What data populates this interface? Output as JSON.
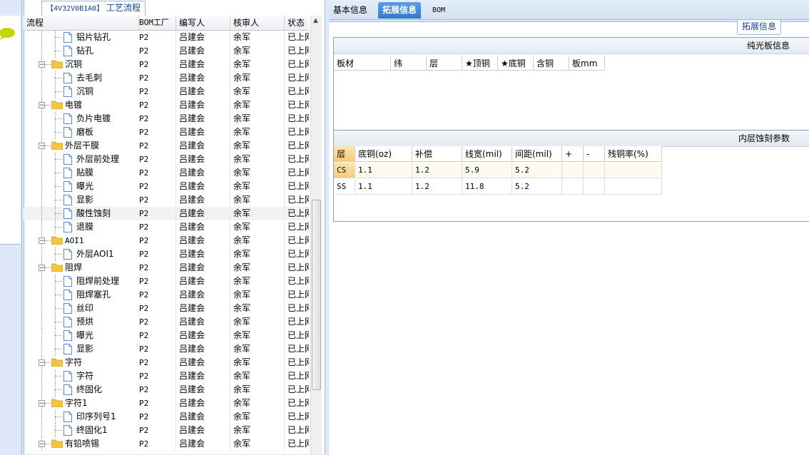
{
  "tree_panel": {
    "title_code": "【4V32V0B1A0】",
    "title": "工艺流程",
    "columns": [
      "流程",
      "BOM工厂",
      "编写人",
      "核审人",
      "状态"
    ],
    "rows": [
      {
        "name": "铝片钻孔",
        "type": "leaf",
        "factory": "P2",
        "writer": "吕建会",
        "reviewer": "余军",
        "status": "已上网"
      },
      {
        "name": "钻孔",
        "type": "leaf",
        "factory": "P2",
        "writer": "吕建会",
        "reviewer": "余军",
        "status": "已上网"
      },
      {
        "name": "沉铜",
        "type": "folder",
        "factory": "P2",
        "writer": "吕建会",
        "reviewer": "余军",
        "status": "已上网"
      },
      {
        "name": "去毛刺",
        "type": "leaf",
        "factory": "P2",
        "writer": "吕建会",
        "reviewer": "余军",
        "status": "已上网"
      },
      {
        "name": "沉铜",
        "type": "leaf",
        "factory": "P2",
        "writer": "吕建会",
        "reviewer": "余军",
        "status": "已上网"
      },
      {
        "name": "电镀",
        "type": "folder",
        "factory": "P2",
        "writer": "吕建会",
        "reviewer": "余军",
        "status": "已上网"
      },
      {
        "name": "负片电镀",
        "type": "leaf",
        "factory": "P2",
        "writer": "吕建会",
        "reviewer": "余军",
        "status": "已上网"
      },
      {
        "name": "磨板",
        "type": "leaf",
        "factory": "P2",
        "writer": "吕建会",
        "reviewer": "余军",
        "status": "已上网"
      },
      {
        "name": "外层干膜",
        "type": "folder",
        "factory": "P2",
        "writer": "吕建会",
        "reviewer": "余军",
        "status": "已上网"
      },
      {
        "name": "外层前处理",
        "type": "leaf",
        "factory": "P2",
        "writer": "吕建会",
        "reviewer": "余军",
        "status": "已上网"
      },
      {
        "name": "贴膜",
        "type": "leaf",
        "factory": "P2",
        "writer": "吕建会",
        "reviewer": "余军",
        "status": "已上网"
      },
      {
        "name": "曝光",
        "type": "leaf",
        "factory": "P2",
        "writer": "吕建会",
        "reviewer": "余军",
        "status": "已上网"
      },
      {
        "name": "显影",
        "type": "leaf",
        "factory": "P2",
        "writer": "吕建会",
        "reviewer": "余军",
        "status": "已上网"
      },
      {
        "name": "酸性蚀刻",
        "type": "leaf",
        "factory": "P2",
        "writer": "吕建会",
        "reviewer": "余军",
        "status": "已上网",
        "selected": true
      },
      {
        "name": "退膜",
        "type": "leaf",
        "factory": "P2",
        "writer": "吕建会",
        "reviewer": "余军",
        "status": "已上网"
      },
      {
        "name": "AOI1",
        "type": "folder",
        "factory": "P2",
        "writer": "吕建会",
        "reviewer": "余军",
        "status": "已上网"
      },
      {
        "name": "外层AOI1",
        "type": "leaf",
        "factory": "P2",
        "writer": "吕建会",
        "reviewer": "余军",
        "status": "已上网"
      },
      {
        "name": "阻焊",
        "type": "folder",
        "factory": "P2",
        "writer": "吕建会",
        "reviewer": "余军",
        "status": "已上网"
      },
      {
        "name": "阻焊前处理",
        "type": "leaf",
        "factory": "P2",
        "writer": "吕建会",
        "reviewer": "余军",
        "status": "已上网"
      },
      {
        "name": "阻焊塞孔",
        "type": "leaf",
        "factory": "P2",
        "writer": "吕建会",
        "reviewer": "余军",
        "status": "已上网"
      },
      {
        "name": "丝印",
        "type": "leaf",
        "factory": "P2",
        "writer": "吕建会",
        "reviewer": "余军",
        "status": "已上网"
      },
      {
        "name": "预烘",
        "type": "leaf",
        "factory": "P2",
        "writer": "吕建会",
        "reviewer": "余军",
        "status": "已上网"
      },
      {
        "name": "曝光",
        "type": "leaf",
        "factory": "P2",
        "writer": "吕建会",
        "reviewer": "余军",
        "status": "已上网"
      },
      {
        "name": "显影",
        "type": "leaf",
        "factory": "P2",
        "writer": "吕建会",
        "reviewer": "余军",
        "status": "已上网"
      },
      {
        "name": "字符",
        "type": "folder",
        "factory": "P2",
        "writer": "吕建会",
        "reviewer": "余军",
        "status": "已上网"
      },
      {
        "name": "字符",
        "type": "leaf",
        "factory": "P2",
        "writer": "吕建会",
        "reviewer": "余军",
        "status": "已上网"
      },
      {
        "name": "终固化",
        "type": "leaf",
        "factory": "P2",
        "writer": "吕建会",
        "reviewer": "余军",
        "status": "已上网"
      },
      {
        "name": "字符1",
        "type": "folder",
        "factory": "P2",
        "writer": "吕建会",
        "reviewer": "余军",
        "status": "已上网"
      },
      {
        "name": "印序列号1",
        "type": "leaf",
        "factory": "P2",
        "writer": "吕建会",
        "reviewer": "余军",
        "status": "已上网"
      },
      {
        "name": "终固化1",
        "type": "leaf",
        "factory": "P2",
        "writer": "吕建会",
        "reviewer": "余军",
        "status": "已上网"
      },
      {
        "name": "有铅喷锡",
        "type": "folder",
        "factory": "P2",
        "writer": "吕建会",
        "reviewer": "余军",
        "status": "已上网"
      }
    ]
  },
  "tabs": [
    {
      "label": "基本信息",
      "active": false
    },
    {
      "label": "拓展信息",
      "active": true
    },
    {
      "label": "BOM",
      "active": false
    }
  ],
  "subtab_label": "拓展信息",
  "bare_board": {
    "title": "纯光板信息",
    "columns": [
      "板材",
      "纬",
      "层",
      "★顶铜",
      "★底铜",
      "含铜",
      "板mm"
    ]
  },
  "inner_etch": {
    "title": "内层蚀刻参数",
    "columns": [
      "层",
      "底铜(oz)",
      "补偿",
      "线宽(mil)",
      "间距(mil)",
      "+",
      "-",
      "残铜率(%)"
    ],
    "rows": [
      [
        "CS",
        "1.1",
        "1.2",
        "5.9",
        "5.2",
        "",
        "",
        ""
      ],
      [
        "SS",
        "1.1",
        "1.2",
        "11.8",
        "5.2",
        "",
        "",
        ""
      ]
    ]
  },
  "colors": {
    "accent": "#2f78cc",
    "border": "#99bbe8",
    "folder": "#f5c542"
  }
}
